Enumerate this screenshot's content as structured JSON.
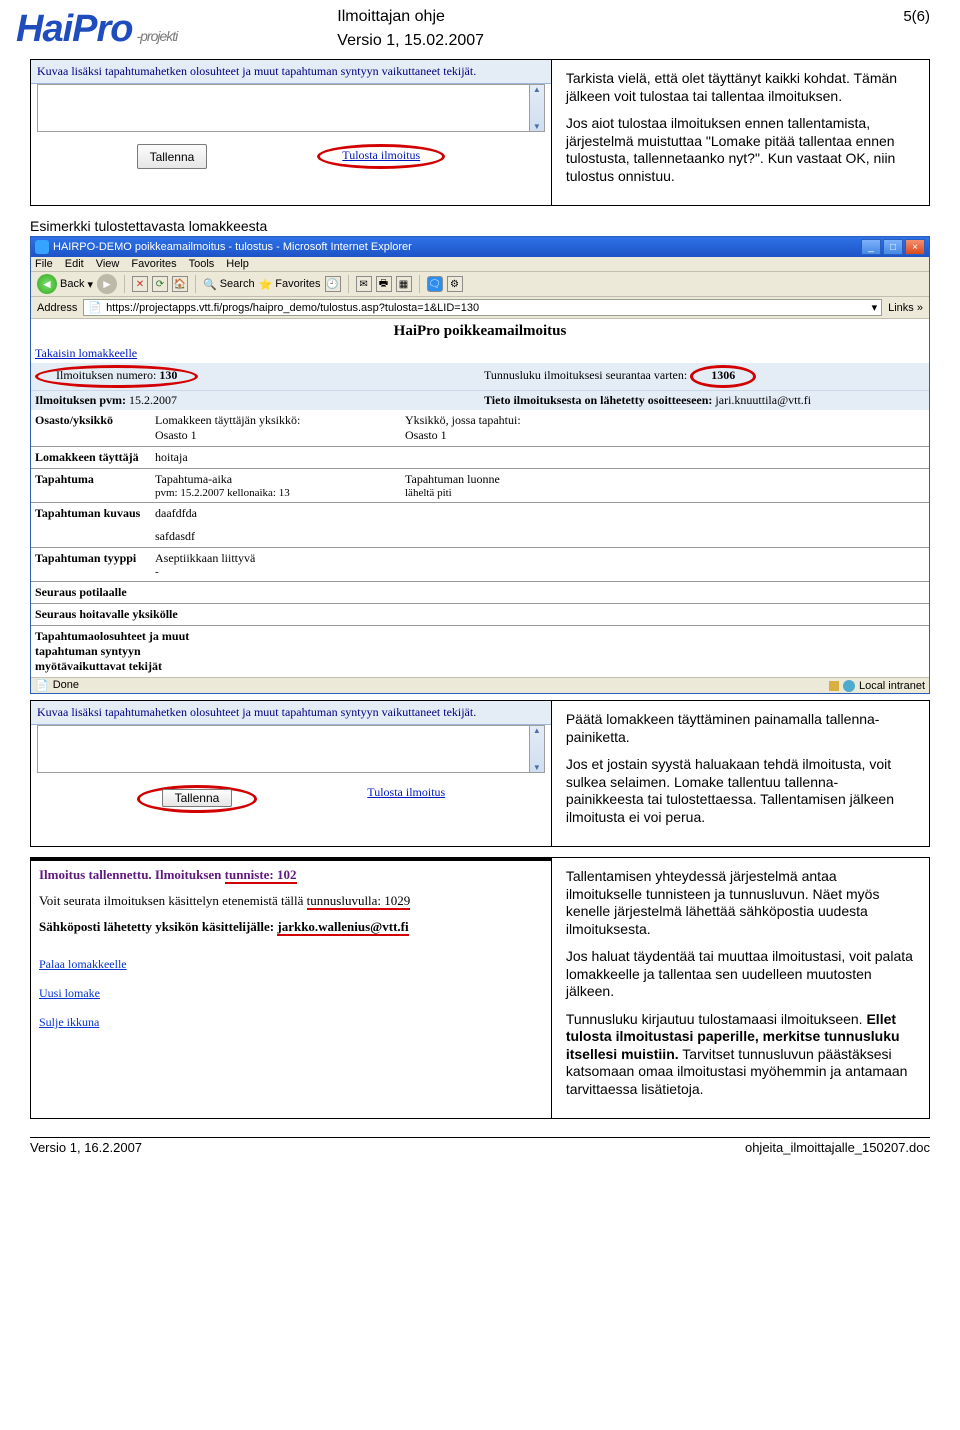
{
  "header": {
    "logo_text": "HaiPro",
    "logo_sub": "-projekti",
    "title": "Ilmoittajan ohje",
    "version_line": "Versio 1, 15.02.2007",
    "page_num": "5(6)"
  },
  "block1": {
    "form_instruction": "Kuvaa lisäksi tapahtumahetken olosuhteet ja muut tapahtuman syntyyn vaikuttaneet tekijät.",
    "save_btn": "Tallenna",
    "print_link": "Tulosta ilmoitus",
    "p1": "Tarkista vielä, että olet täyttänyt kaikki kohdat. Tämän jälkeen voit tulostaa tai tallentaa ilmoituksen.",
    "p2": "Jos aiot tulostaa ilmoituksen ennen tallentamista, järjestelmä muistuttaa \"Lomake pitää tallentaa ennen tulostusta, tallennetaanko nyt?\". Kun vastaat OK, niin tulostus onnistuu."
  },
  "subtitle_example": "Esimerkki tulostettavasta lomakkeesta",
  "browser": {
    "title": "HAIRPO-DEMO poikkeamailmoitus - tulostus - Microsoft Internet Explorer",
    "menu": [
      "File",
      "Edit",
      "View",
      "Favorites",
      "Tools",
      "Help"
    ],
    "back": "Back",
    "search": "Search",
    "favorites": "Favorites",
    "address_label": "Address",
    "url": "https://projectapps.vtt.fi/progs/haipro_demo/tulostus.asp?tulosta=1&LID=130",
    "links_label": "Links",
    "doc_title": "HaiPro poikkeamailmoitus",
    "back_to_form": "Takaisin lomakkeelle",
    "row1_left_label": "Ilmoituksen numero:",
    "row1_left_val": "130",
    "row1_right_label": "Tunnusluku ilmoituksesi seurantaa varten:",
    "row1_right_val": "1306",
    "row2_left_label": "Ilmoituksen pvm:",
    "row2_left_val": "15.2.2007",
    "row2_right_label": "Tieto ilmoituksesta on lähetetty osoitteeseen:",
    "row2_right_val": "jari.knuuttila@vtt.fi",
    "rows": {
      "osasto_lab": "Osasto/yksikkö",
      "osasto_mid1": "Lomakkeen täyttäjän yksikkö:",
      "osasto_mid2": "Osasto 1",
      "osasto_right1": "Yksikkö, jossa tapahtui:",
      "osasto_right2": "Osasto 1",
      "tayttaja_lab": "Lomakkeen täyttäjä",
      "tayttaja_val": "hoitaja",
      "tapahtuma_lab": "Tapahtuma",
      "tapahtuma_mid1": "Tapahtuma-aika",
      "tapahtuma_mid2": "pvm: 15.2.2007    kellonaika: 13",
      "tapahtuma_right1": "Tapahtuman luonne",
      "tapahtuma_right2": "läheltä piti",
      "kuvaus_lab": "Tapahtuman kuvaus",
      "kuvaus_val1": "daafdfda",
      "kuvaus_val2": "safdasdf",
      "tyyppi_lab": "Tapahtuman tyyppi",
      "tyyppi_val": "Aseptiikkaan liittyvä",
      "seuraus_pot_lab": "Seuraus potilaalle",
      "seuraus_yks_lab": "Seuraus hoitavalle yksikölle",
      "olosuhteet_lab": "Tapahtumaolosuhteet ja muut tapahtuman syntyyn myötävaikuttavat tekijät"
    },
    "status_done": "Done",
    "status_zone": "Local intranet"
  },
  "block2": {
    "form_instruction": "Kuvaa lisäksi tapahtumahetken olosuhteet ja muut tapahtuman syntyyn vaikuttaneet tekijät.",
    "save_btn": "Tallenna",
    "print_link": "Tulosta ilmoitus",
    "p1": "Päätä lomakkeen täyttäminen painamalla tallenna-painiketta.",
    "p2": "Jos et jostain syystä haluakaan tehdä ilmoitusta, voit sulkea selaimen. Lomake tallentuu tallenna-painikkeesta tai tulostettaessa. Tallentamisen jälkeen ilmoitusta ei voi perua."
  },
  "block3": {
    "confirm": {
      "ln1a": "Ilmoitus tallennettu. Ilmoituksen ",
      "ln1b": "tunniste: 102",
      "ln2a": "Voit seurata ilmoituksen käsittelyn etenemistä tällä ",
      "ln2b": "tunnusluvulla: 1029",
      "ln3a": "Sähköposti lähetetty yksikön käsittelijälle: ",
      "ln3b": "jarkko.wallenius@vtt.fi",
      "link1": "Palaa lomakkeelle",
      "link2": "Uusi lomake",
      "link3": "Sulje ikkuna"
    },
    "p1": "Tallentamisen yhteydessä järjestelmä antaa ilmoitukselle tunnisteen ja tunnusluvun. Näet myös kenelle järjestelmä lähettää sähköpostia uudesta ilmoituksesta.",
    "p2": "Jos haluat täydentää tai muuttaa ilmoitustasi, voit palata lomakkeelle ja tallentaa sen uudelleen muutosten jälkeen.",
    "p3a": "Tunnusluku kirjautuu tulostamaasi ilmoitukseen. ",
    "p3b": "Ellet tulosta ilmoitustasi paperille, merkitse tunnusluku itsellesi muistiin.",
    "p3c": " Tarvitset tunnusluvun päästäksesi katsomaan omaa ilmoitustasi myöhemmin ja antamaan tarvittaessa lisätietoja."
  },
  "footer": {
    "left": "Versio 1, 16.2.2007",
    "right": "ohjeita_ilmoittajalle_150207.doc"
  }
}
